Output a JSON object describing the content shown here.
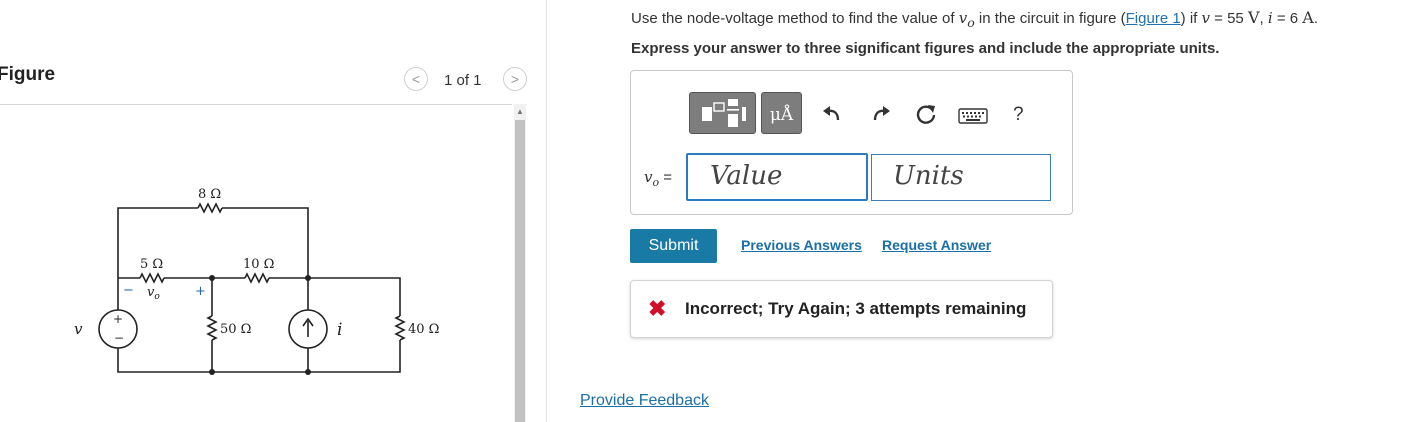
{
  "figure_panel": {
    "title": "Figure",
    "prev_symbol": "<",
    "next_symbol": ">",
    "page_count": "1 of 1"
  },
  "circuit": {
    "r_top": "8 Ω",
    "r_left": "5 Ω",
    "r_mid": "10 Ω",
    "r_50": "50 Ω",
    "r_40": "40 Ω",
    "vo_label": "v",
    "vo_sub": "o",
    "source_v": "v",
    "source_i": "i",
    "minus": "−",
    "plus": "+",
    "src_plus": "+",
    "src_minus": "−"
  },
  "question": {
    "prefix": "Use the node-voltage method to find the value of ",
    "var_v": "v",
    "var_sub": "o",
    "middle": " in the circuit in figure (",
    "figure_link": "Figure 1",
    "after_link": ") if ",
    "v_var": "v",
    "v_eq": " = 55 ",
    "v_unit": "V",
    "sep": ", ",
    "i_var": "i",
    "i_eq": " = 6 ",
    "i_unit": "A",
    "end": "."
  },
  "instruction": "Express your answer to three significant figures and include the appropriate units.",
  "toolbar": {
    "symbols_label": "μÅ",
    "help_label": "?"
  },
  "answer": {
    "var_label": "v",
    "var_sub": "o",
    "equals": " =",
    "value_placeholder": "Value",
    "units_placeholder": "Units"
  },
  "actions": {
    "submit": "Submit",
    "previous_answers": "Previous Answers",
    "request_answer": "Request Answer"
  },
  "feedback": {
    "icon": "✖",
    "message": "Incorrect; Try Again; 3 attempts remaining"
  },
  "provide_feedback": "Provide Feedback",
  "colors": {
    "link": "#1a6fa6",
    "submit_bg": "#1a7aa6",
    "error": "#d0102b",
    "focus_border": "#2b7bc0"
  }
}
